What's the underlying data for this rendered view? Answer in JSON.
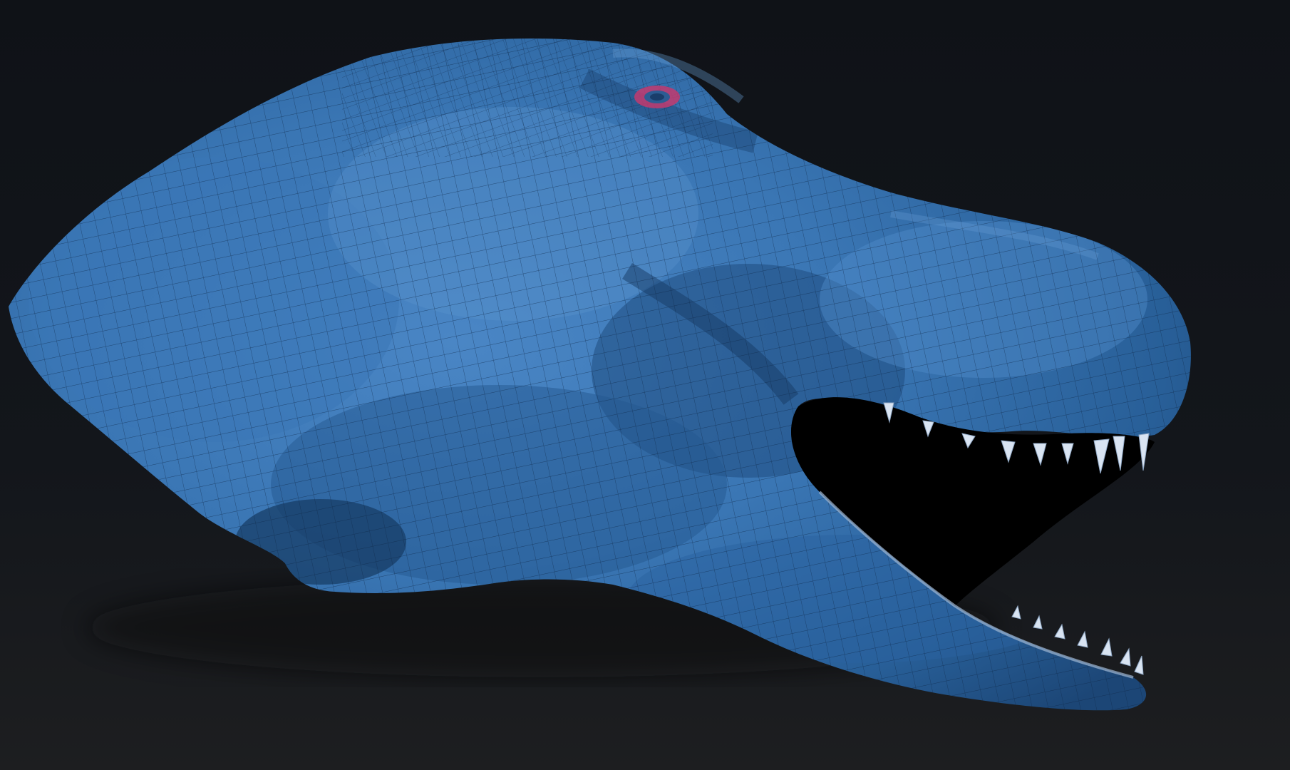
{
  "scene": {
    "subject": "dinosaur-head-sculpt",
    "background_colors": {
      "top": "#0f1217",
      "middle": "#13161b",
      "bottom": "#1d1e20"
    },
    "model_colors": {
      "base": "#2f6aa6",
      "highlight": "#4f8ccc",
      "shadow": "#1f4b7c",
      "deep_shadow": "#163a63",
      "wireframe": "#0d2746",
      "eye_mark": "#d8407a",
      "teeth": "#d9e4f2"
    },
    "wireframe_visible": true
  }
}
